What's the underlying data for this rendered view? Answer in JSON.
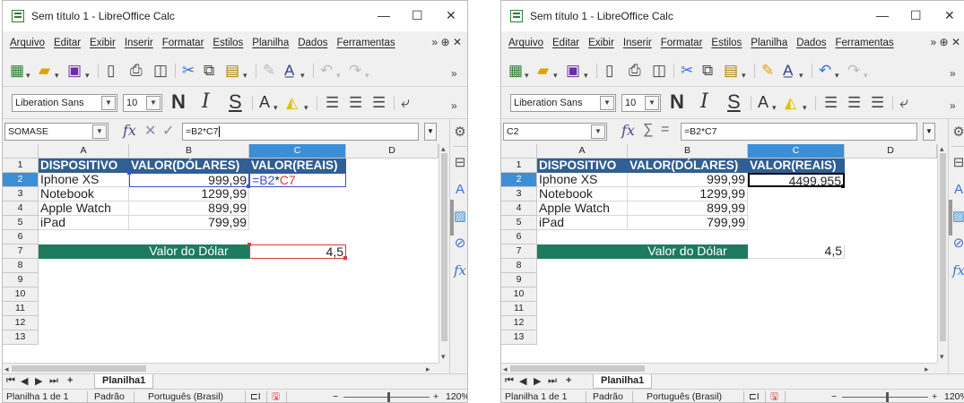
{
  "windows": [
    {
      "title": "Sem título 1 - LibreOffice Calc",
      "menu": [
        "Arquivo",
        "Editar",
        "Exibir",
        "Inserir",
        "Formatar",
        "Estilos",
        "Planilha",
        "Dados",
        "Ferramentas"
      ],
      "font_name": "Liberation Sans",
      "font_size": "10",
      "name_box": "SOMASE",
      "formula": "=B2*C7",
      "columns": [
        "A",
        "B",
        "C",
        "D"
      ],
      "rows": [
        "1",
        "2",
        "3",
        "4",
        "5",
        "6",
        "7",
        "8",
        "9",
        "10",
        "11",
        "12",
        "13"
      ],
      "headers": [
        "DISPOSITIVO",
        "VALOR(DÓLARES)",
        "VALOR(REAIS)"
      ],
      "items": [
        {
          "name": "Iphone XS",
          "usd": "999,99"
        },
        {
          "name": "Notebook",
          "usd": "1299,99"
        },
        {
          "name": "Apple Watch",
          "usd": "899,99"
        },
        {
          "name": "iPad",
          "usd": "799,99"
        }
      ],
      "c2": "",
      "c2_formula": {
        "eq": "=",
        "ref1": "B2",
        "op": "*",
        "ref2": "C7"
      },
      "rate_label": "Valor do Dólar",
      "rate_value": "4,5",
      "sheet_tab": "Planilha1",
      "status": {
        "sheet": "Planilha 1 de 1",
        "style": "Padrão",
        "lang": "Português (Brasil)",
        "zoom": "120%"
      }
    },
    {
      "title": "Sem título 1 - LibreOffice Calc",
      "menu": [
        "Arquivo",
        "Editar",
        "Exibir",
        "Inserir",
        "Formatar",
        "Estilos",
        "Planilha",
        "Dados",
        "Ferramentas"
      ],
      "font_name": "Liberation Sans",
      "font_size": "10",
      "name_box": "C2",
      "formula": "=B2*C7",
      "columns": [
        "A",
        "B",
        "C",
        "D"
      ],
      "rows": [
        "1",
        "2",
        "3",
        "4",
        "5",
        "6",
        "7",
        "8",
        "9",
        "10",
        "11",
        "12",
        "13"
      ],
      "headers": [
        "DISPOSITIVO",
        "VALOR(DÓLARES)",
        "VALOR(REAIS)"
      ],
      "items": [
        {
          "name": "Iphone XS",
          "usd": "999,99"
        },
        {
          "name": "Notebook",
          "usd": "1299,99"
        },
        {
          "name": "Apple Watch",
          "usd": "899,99"
        },
        {
          "name": "iPad",
          "usd": "799,99"
        }
      ],
      "c2": "4499,955",
      "rate_label": "Valor do Dólar",
      "rate_value": "4,5",
      "sheet_tab": "Planilha1",
      "status": {
        "sheet": "Planilha 1 de 1",
        "style": "Padrão",
        "lang": "Português (Brasil)",
        "zoom": "120%"
      }
    }
  ],
  "accent": {
    "header_fill": "#2f5f94",
    "rate_fill": "#1f7a5e",
    "selection": "#3b8fd6"
  }
}
